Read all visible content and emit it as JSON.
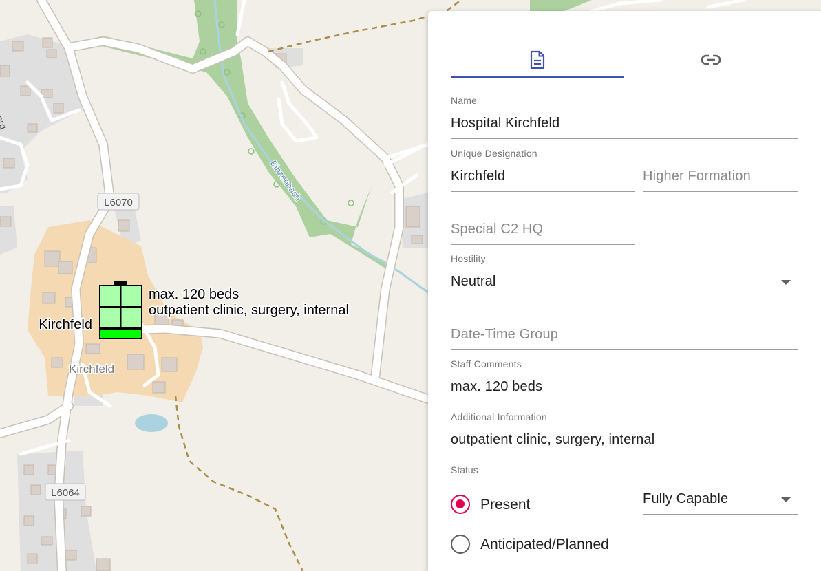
{
  "map": {
    "road_labels": [
      "L6070",
      "L6064"
    ],
    "place_labels": [
      "Kirchfeld"
    ],
    "water_labels": [
      "Einzenbach"
    ],
    "partial_label": "org",
    "unit_symbol": {
      "designation": "Kirchfeld",
      "staff_comments": "max. 120 beds",
      "additional_info": "outpatient clinic, surgery, internal",
      "fill_color": "#aaffaa",
      "status_bar_color": "#00ff00"
    }
  },
  "panel": {
    "tabs": [
      {
        "icon": "document-icon",
        "active": true
      },
      {
        "icon": "link-icon",
        "active": false
      }
    ],
    "accent_color": "#3f51b5",
    "radio_color": "#e0004d",
    "fields": {
      "name": {
        "label": "Name",
        "value": "Hospital Kirchfeld"
      },
      "unique_designation": {
        "label": "Unique Designation",
        "value": "Kirchfeld"
      },
      "higher_formation": {
        "placeholder": "Higher Formation"
      },
      "special_c2_hq": {
        "placeholder": "Special C2 HQ"
      },
      "hostility": {
        "label": "Hostility",
        "value": "Neutral"
      },
      "date_time_group": {
        "placeholder": "Date-Time Group"
      },
      "staff_comments": {
        "label": "Staff Comments",
        "value": "max. 120 beds"
      },
      "additional_information": {
        "label": "Additional Information",
        "value": "outpatient clinic, surgery, internal"
      },
      "status": {
        "label": "Status",
        "options": [
          {
            "label": "Present",
            "checked": true
          },
          {
            "label": "Anticipated/Planned",
            "checked": false
          }
        ],
        "capability": "Fully Capable"
      }
    }
  }
}
